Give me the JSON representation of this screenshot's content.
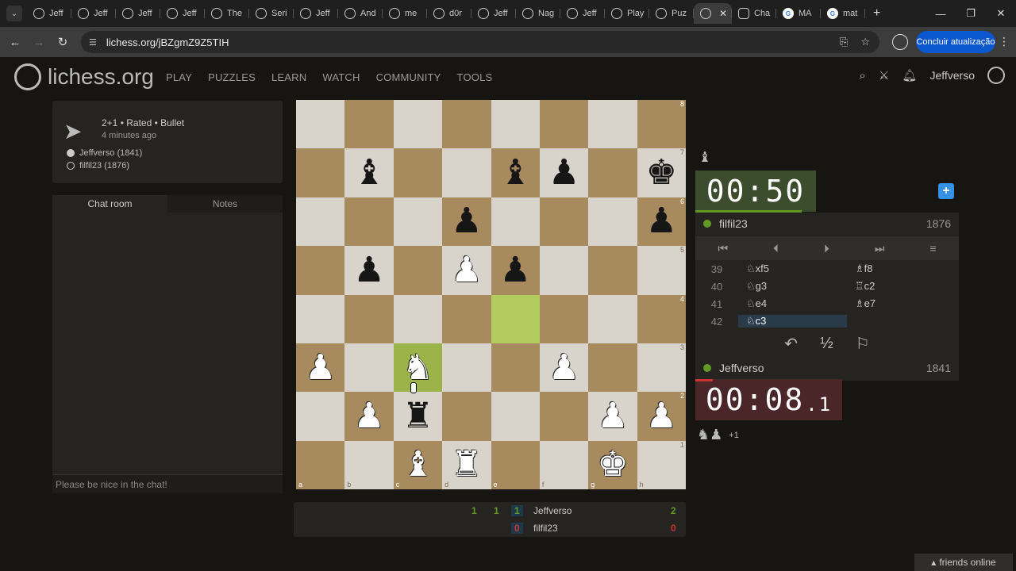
{
  "browser": {
    "tabs": [
      "Jeff",
      "Jeff",
      "Jeff",
      "Jeff",
      "The",
      "Seri",
      "Jeff",
      "And",
      "me",
      "d0r",
      "Jeff",
      "Nag",
      "Jeff",
      "Play",
      "Puz",
      "",
      "Cha",
      "MA",
      "mat"
    ],
    "url": "lichess.org/jBZgmZ9Z5TIH",
    "update_label": "Concluir atualização"
  },
  "site": {
    "logo_main": "lichess",
    "logo_tld": ".org",
    "nav": [
      "PLAY",
      "PUZZLES",
      "LEARN",
      "WATCH",
      "COMMUNITY",
      "TOOLS"
    ],
    "username": "Jeffverso"
  },
  "game_info": {
    "type": "2+1 • Rated • Bullet",
    "time_ago": "4 minutes ago",
    "white_player": "Jeffverso (1841)",
    "black_player": "filfil23 (1876)"
  },
  "chat": {
    "tab_chat": "Chat room",
    "tab_notes": "Notes",
    "input_placeholder": "Please be nice in the chat!"
  },
  "board": {
    "rows": [
      [
        "",
        "",
        "",
        "",
        "",
        "",
        "",
        ""
      ],
      [
        "",
        "b",
        "",
        "",
        "b",
        "p",
        "",
        "k"
      ],
      [
        "",
        "",
        "",
        "p",
        "",
        "",
        "",
        "p"
      ],
      [
        "",
        "p",
        "",
        "P",
        "p",
        "",
        "",
        ""
      ],
      [
        "",
        "",
        "",
        "",
        "",
        "",
        "",
        ""
      ],
      [
        "P",
        "",
        "N",
        "",
        "",
        "P",
        "",
        ""
      ],
      [
        "",
        "P",
        "r",
        "",
        "",
        "",
        "P",
        "P"
      ],
      [
        "",
        "",
        "B",
        "R",
        "",
        "",
        "K",
        ""
      ]
    ],
    "highlights": [
      [
        4,
        4
      ],
      [
        5,
        2
      ]
    ],
    "ranks": [
      "8",
      "7",
      "6",
      "5",
      "4",
      "3",
      "2",
      "1"
    ],
    "files": [
      "a",
      "b",
      "c",
      "d",
      "e",
      "f",
      "g",
      "h"
    ]
  },
  "opponent": {
    "name": "filfil23",
    "rating": "1876",
    "clock": "00:50",
    "pocket_icon": "♝"
  },
  "me": {
    "name": "Jeffverso",
    "rating": "1841",
    "clock_main": "00:08",
    "clock_tenths": ".1",
    "pocket": "♞♟",
    "pocket_plus": "+1"
  },
  "moves": [
    {
      "n": "39",
      "w": "♘xf5",
      "b": "♗f8"
    },
    {
      "n": "40",
      "w": "♘g3",
      "b": "♖c2"
    },
    {
      "n": "41",
      "w": "♘e4",
      "b": "♗e7"
    },
    {
      "n": "42",
      "w": "♘c3",
      "b": ""
    }
  ],
  "crosstable": {
    "score_a_top": "1",
    "score_b_top": "1",
    "score_c_top": "1",
    "player1": "Jeffverso",
    "total1": "2",
    "score_c_bot": "0",
    "player2": "filfil23",
    "total2": "0"
  },
  "friends_label": "friends online",
  "colors": {
    "accent_green": "#629924",
    "accent_blue": "#3692e7",
    "clock_red": "#4a2628"
  }
}
